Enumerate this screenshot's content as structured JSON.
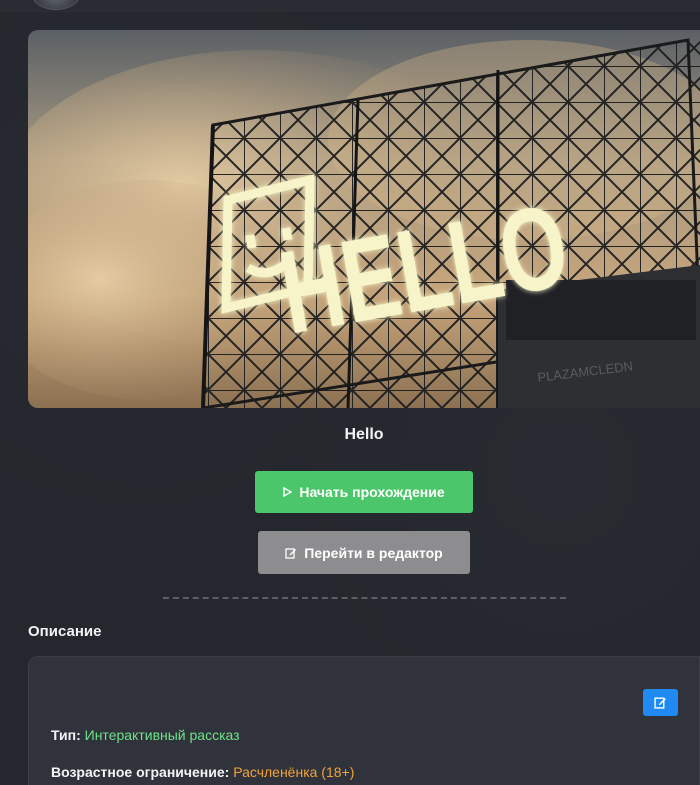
{
  "story": {
    "cover_sign_text": "HELLO",
    "cover_building_text": "PLAZAMCLEDN",
    "title": "Hello"
  },
  "actions": {
    "start_label": "Начать прохождение",
    "editor_label": "Перейти в редактор"
  },
  "description": {
    "section_title": "Описание",
    "type_key": "Тип:",
    "type_value": "Интерактивный рассказ",
    "age_key": "Возрастное ограничение:",
    "age_value": "Расчленёнка (18+)"
  },
  "colors": {
    "background": "#25272e",
    "start_button": "#4cc66a",
    "editor_button": "#8d8d8f",
    "edit_icon_button": "#1f8bf2",
    "type_value": "#6ee389",
    "age_value": "#f2a23a"
  },
  "icons": {
    "start": "play-outline-icon",
    "editor": "edit-icon",
    "description_edit": "edit-icon"
  }
}
